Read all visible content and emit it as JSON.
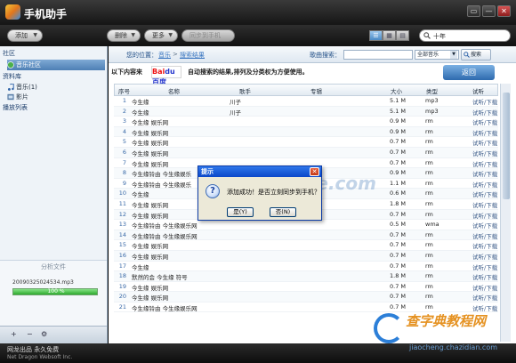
{
  "app": {
    "title": "手机助手",
    "window_buttons": [
      "▭",
      "—",
      "✕"
    ]
  },
  "toolbar": {
    "add_label": "添加",
    "delete_label": "删除",
    "more_label": "更多",
    "sync_label": "同步到手机",
    "search_value": "十年"
  },
  "sidebar": {
    "community": "社区",
    "community_item": "音乐社区",
    "library": "资料库",
    "music_item": "音乐(1)",
    "video_item": "影片",
    "playlists": "播放列表",
    "analyze_header": "分析文件",
    "analyze_file": "20090325024534.mp3",
    "progress_value": 100,
    "progress_label": "100 %",
    "bottom_buttons": [
      "+",
      "−",
      "⚙"
    ]
  },
  "main": {
    "location_label": "您的位置：",
    "crumb_music": "音乐",
    "crumb_sep": ">",
    "crumb_results": "搜索结果",
    "song_search_label": "歌曲搜索：",
    "scope_value": "全部音乐",
    "search_button": "搜索",
    "info_prefix": "以下内容来",
    "baidu_a": "Bai",
    "baidu_b": "du百度",
    "info_suffix": "自动搜索的结果,排列及分类权为方便使用。",
    "back_button": "返回"
  },
  "table": {
    "headers": [
      "序号",
      "名称",
      "歌手",
      "专辑",
      "大小",
      "类型",
      "试听"
    ],
    "rows": [
      {
        "no": "1",
        "name": "今生缘",
        "artist": "川子",
        "size": "5.1 M",
        "type": "mp3",
        "act": "试听/下载"
      },
      {
        "no": "2",
        "name": "今生缘",
        "artist": "川子",
        "size": "5.1 M",
        "type": "mp3",
        "act": "试听/下载"
      },
      {
        "no": "3",
        "name": "今生缘 娱乐网",
        "artist": "",
        "size": "0.9 M",
        "type": "rm",
        "act": "试听/下载"
      },
      {
        "no": "4",
        "name": "今生缘 娱乐网",
        "artist": "",
        "size": "0.9 M",
        "type": "rm",
        "act": "试听/下载"
      },
      {
        "no": "5",
        "name": "今生缘 娱乐网",
        "artist": "",
        "size": "0.7 M",
        "type": "rm",
        "act": "试听/下载"
      },
      {
        "no": "6",
        "name": "今生缘 娱乐网",
        "artist": "",
        "size": "0.7 M",
        "type": "rm",
        "act": "试听/下载"
      },
      {
        "no": "7",
        "name": "今生缘 娱乐网",
        "artist": "",
        "size": "0.7 M",
        "type": "rm",
        "act": "试听/下载"
      },
      {
        "no": "8",
        "name": "今生缘铃由 今生缘娱乐",
        "artist": "",
        "size": "0.9 M",
        "type": "rm",
        "act": "试听/下载"
      },
      {
        "no": "9",
        "name": "今生缘铃由 今生缘娱乐",
        "artist": "",
        "size": "1.1 M",
        "type": "rm",
        "act": "试听/下载"
      },
      {
        "no": "10",
        "name": "今生缘",
        "artist": "",
        "size": "0.6 M",
        "type": "rm",
        "act": "试听/下载"
      },
      {
        "no": "11",
        "name": "今生缘 娱乐网",
        "artist": "",
        "size": "1.8 M",
        "type": "rm",
        "act": "试听/下载"
      },
      {
        "no": "12",
        "name": "今生缘 娱乐网",
        "artist": "",
        "size": "0.7 M",
        "type": "rm",
        "act": "试听/下载"
      },
      {
        "no": "13",
        "name": "今生缘铃由 今生缘娱乐网",
        "artist": "",
        "size": "0.5 M",
        "type": "wma",
        "act": "试听/下载"
      },
      {
        "no": "14",
        "name": "今生缘铃由 今生缘娱乐网",
        "artist": "",
        "size": "0.7 M",
        "type": "rm",
        "act": "试听/下载"
      },
      {
        "no": "15",
        "name": "今生缘 娱乐网",
        "artist": "",
        "size": "0.7 M",
        "type": "rm",
        "act": "试听/下载"
      },
      {
        "no": "16",
        "name": "今生缘 娱乐网",
        "artist": "",
        "size": "0.7 M",
        "type": "rm",
        "act": "试听/下载"
      },
      {
        "no": "17",
        "name": "今生缘",
        "artist": "",
        "size": "0.7 M",
        "type": "rm",
        "act": "试听/下载"
      },
      {
        "no": "18",
        "name": "默然的会 今生缘 符号",
        "artist": "",
        "size": "1.8 M",
        "type": "rm",
        "act": "试听/下载"
      },
      {
        "no": "19",
        "name": "今生缘 娱乐网",
        "artist": "",
        "size": "0.7 M",
        "type": "rm",
        "act": "试听/下载"
      },
      {
        "no": "20",
        "name": "今生缘 娱乐网",
        "artist": "",
        "size": "0.7 M",
        "type": "rm",
        "act": "试听/下载"
      },
      {
        "no": "21",
        "name": "今生缘铃由 今生缘娱乐网",
        "artist": "",
        "size": "0.7 M",
        "type": "rm",
        "act": "试听/下载"
      }
    ]
  },
  "dialog": {
    "title": "提示",
    "close": "✕",
    "icon_glyph": "?",
    "message": "添加成功！是否立刻同步到手机？",
    "yes": "是(Y)",
    "no": "否(N)"
  },
  "footer": {
    "line1": "网龙出品 永久免费",
    "line2": "Net Dragon Websoft Inc."
  },
  "watermark": {
    "text_a": "www.DuoTe.com",
    "text_b": "jiaocheng.chazidian.com",
    "text_c": "查字典教程网"
  },
  "colors": {
    "accent": "#4d7fb4",
    "title_bar": "#151515",
    "dialog_title": "#0a47c9",
    "progress": "#2eaa2e"
  }
}
